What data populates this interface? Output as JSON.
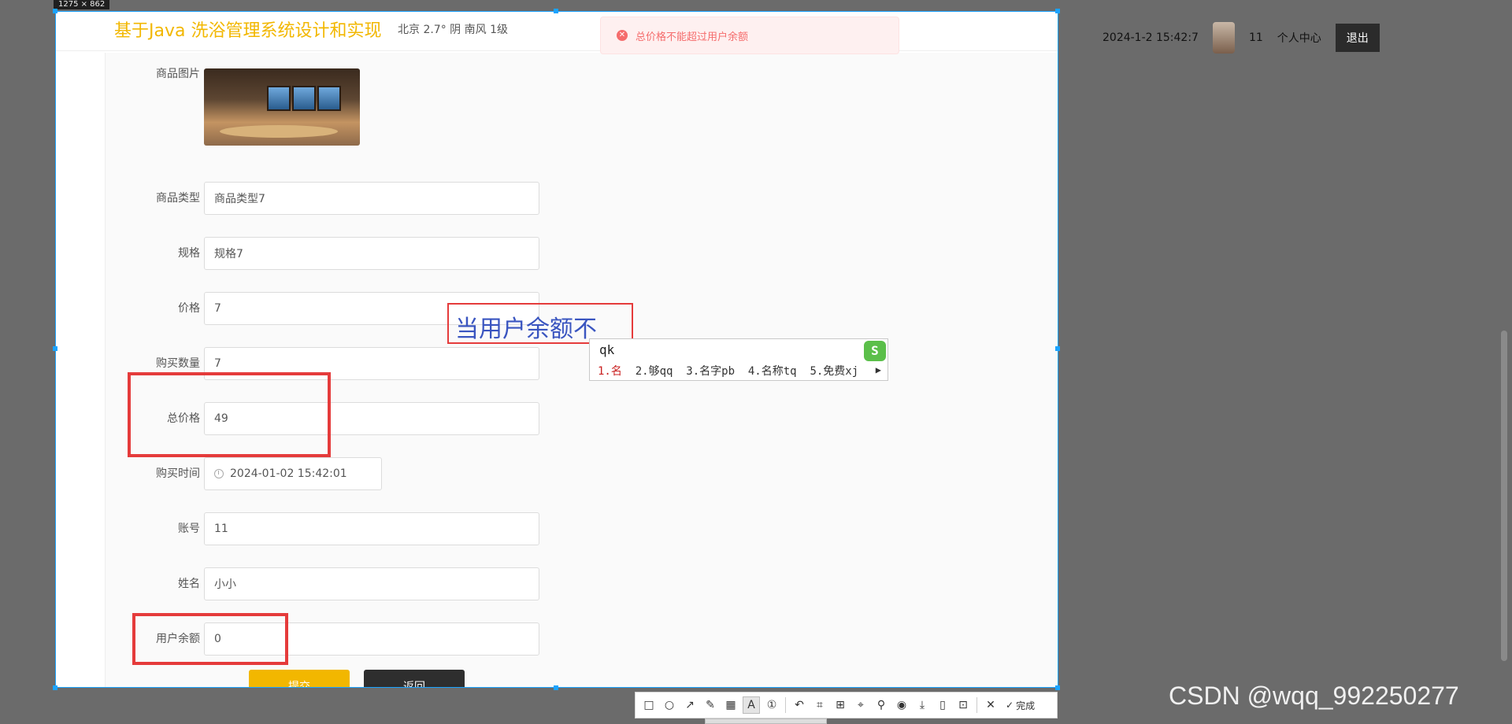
{
  "background_header": {
    "datetime": "2024-1-2 15:42:7",
    "username": "11",
    "profile_label": "个人中心",
    "logout_label": "退出"
  },
  "capture": {
    "size_tag": "1275 × 862"
  },
  "app": {
    "title": "基于Java 洗浴管理系统设计和实现",
    "weather": "北京  2.7°  阴  南风  1级"
  },
  "alert": {
    "message": "总价格不能超过用户余额"
  },
  "form": {
    "image_label": "商品图片",
    "fields": [
      {
        "label": "商品类型",
        "value": "商品类型7"
      },
      {
        "label": "规格",
        "value": "规格7"
      },
      {
        "label": "价格",
        "value": "7"
      },
      {
        "label": "购买数量",
        "value": "7"
      },
      {
        "label": "总价格",
        "value": "49"
      },
      {
        "label": "购买时间",
        "value": "2024-01-02 15:42:01"
      },
      {
        "label": "账号",
        "value": "11"
      },
      {
        "label": "姓名",
        "value": "小小"
      },
      {
        "label": "用户余额",
        "value": "0"
      }
    ],
    "submit_label": "提交",
    "back_label": "返回"
  },
  "text_annotation": "当用户余额不",
  "ime": {
    "input": "qk",
    "candidates": [
      "1.名",
      "2.够qq",
      "3.名字pb",
      "4.名称tq",
      "5.免费xj"
    ],
    "logo": "S"
  },
  "toolbar": {
    "tools": [
      "rectangle-icon",
      "ellipse-icon",
      "arrow-icon",
      "pen-icon",
      "mosaic-icon",
      "text-icon",
      "number-icon",
      "undo-icon",
      "ocr-icon",
      "translate-icon",
      "scan-icon",
      "pin-icon",
      "record-icon",
      "save-icon",
      "long-capture-icon",
      "bookmark-icon",
      "close-icon"
    ],
    "done_label": "完成"
  },
  "watermark": "CSDN @wqq_992250277",
  "colors": {
    "accent": "#f2b700",
    "error": "#f56c6c",
    "annotation": "#e53b3b",
    "selection": "#1aa3ff"
  }
}
